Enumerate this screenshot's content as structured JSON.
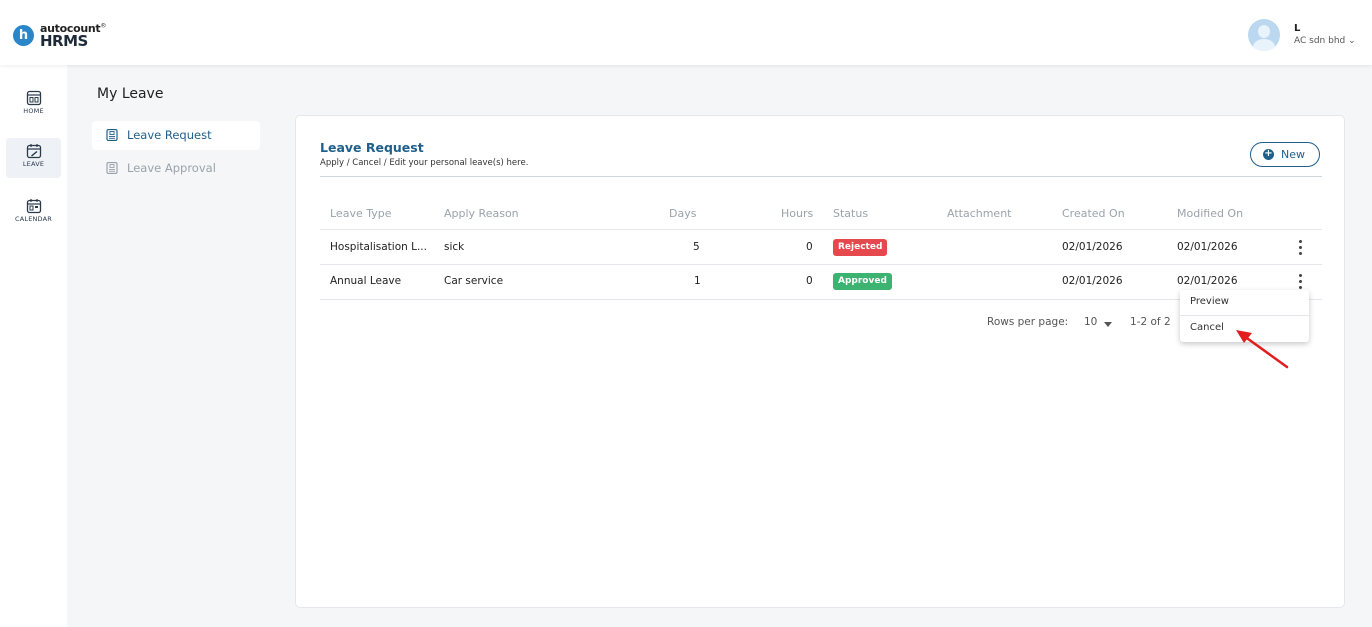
{
  "brand": {
    "logo_top": "autocount",
    "logo_mark": "®",
    "logo_bottom": "HRMS",
    "logo_letter": "h"
  },
  "user": {
    "initial": "L",
    "company": "AC sdn bhd ⌄"
  },
  "rail": [
    {
      "label": "HOME",
      "icon": "home-dashboard-icon"
    },
    {
      "label": "LEAVE",
      "icon": "leave-calendar-icon"
    },
    {
      "label": "CALENDAR",
      "icon": "calendar-icon"
    }
  ],
  "page": {
    "title": "My Leave"
  },
  "subnav": [
    {
      "label": "Leave Request",
      "icon": "document-icon"
    },
    {
      "label": "Leave Approval",
      "icon": "document-icon"
    }
  ],
  "card": {
    "title": "Leave Request",
    "subtitle": "Apply / Cancel / Edit your personal leave(s) here.",
    "new_label": "New",
    "new_icon": "plus-circle-icon"
  },
  "table": {
    "headers": [
      "Leave Type",
      "Apply Reason",
      "Days",
      "Hours",
      "Status",
      "Attachment",
      "Created On",
      "Modified On"
    ],
    "rows": [
      {
        "leave_type": "Hospitalisation L...",
        "reason": "sick",
        "days": "5",
        "hours": "0",
        "status": "Rejected",
        "attachment": "",
        "created": "02/01/2026",
        "modified": "02/01/2026"
      },
      {
        "leave_type": "Annual Leave",
        "reason": "Car service",
        "days": "1",
        "hours": "0",
        "status": "Approved",
        "attachment": "",
        "created": "02/01/2026",
        "modified": "02/01/2026"
      }
    ]
  },
  "pager": {
    "label": "Rows per page:",
    "value": "10",
    "range": "1-2 of 2"
  },
  "row_menu": {
    "items": [
      "Preview",
      "Cancel"
    ]
  },
  "colors": {
    "primary": "#1f5f8b",
    "brand_blue": "#2a86c9",
    "rejected": "#e5484d",
    "approved": "#3cb371",
    "annotation_arrow": "#e11d1d"
  }
}
